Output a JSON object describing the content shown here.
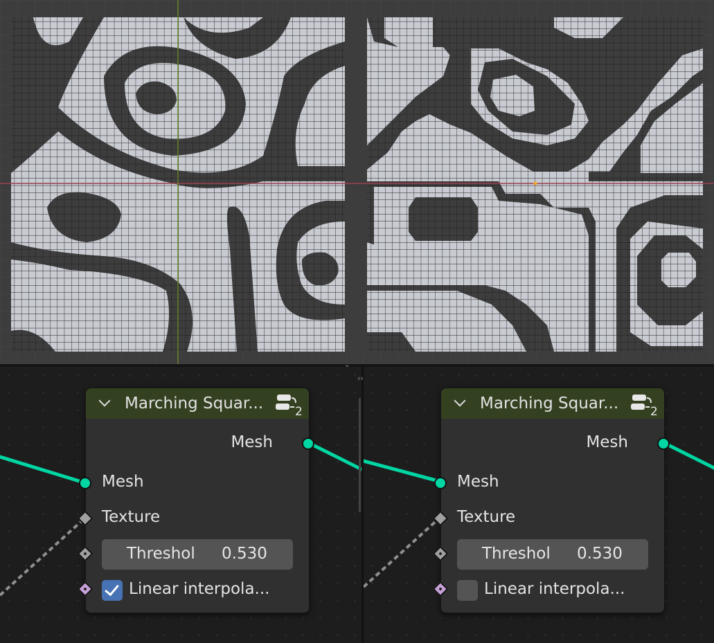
{
  "nodes": [
    {
      "title": "Marching Squar...",
      "group_count": "2",
      "output_mesh": "Mesh",
      "input_mesh": "Mesh",
      "texture": "Texture",
      "threshold_label": "Threshol",
      "threshold_value": "0.530",
      "interp_label": "Linear interpola...",
      "interp_checked": true
    },
    {
      "title": "Marching Squar...",
      "group_count": "2",
      "output_mesh": "Mesh",
      "input_mesh": "Mesh",
      "texture": "Texture",
      "threshold_label": "Threshol",
      "threshold_value": "0.530",
      "interp_label": "Linear interpola...",
      "interp_checked": false
    }
  ],
  "colors": {
    "mesh_socket": "#00d6a3",
    "node_header": "#344121",
    "checkbox_on": "#4772b3",
    "viewport_fill": "#c9cbd2",
    "viewport_background": "#3d3d3d"
  }
}
